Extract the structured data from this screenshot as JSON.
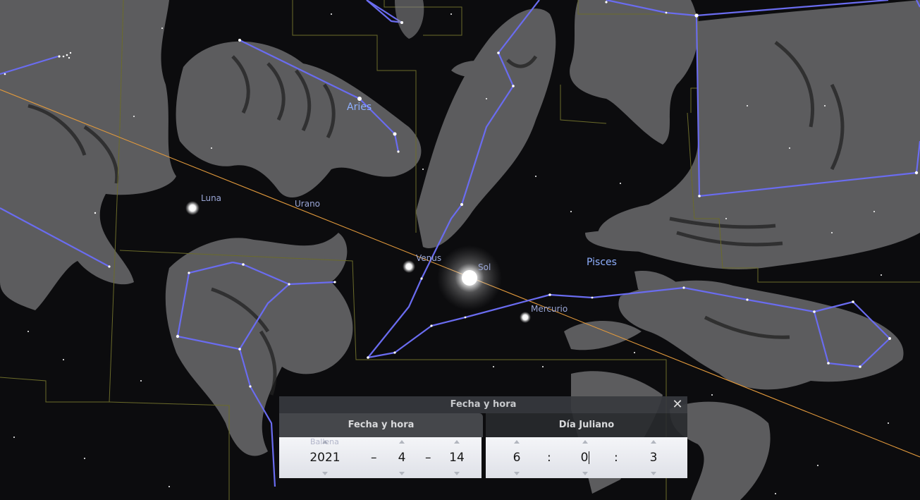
{
  "sky": {
    "labels": {
      "aries": "Aries",
      "pisces": "Pisces",
      "luna": "Luna",
      "urano": "Urano",
      "venus": "Venus",
      "sol": "Sol",
      "mercurio": "Mercurio",
      "ballena": "Ballena"
    },
    "colors": {
      "constellation_lines": "#6a6cf0",
      "ecliptic": "#e39a3c",
      "boundaries": "#6b6b2a",
      "art": "#9a9a9a"
    }
  },
  "dialog": {
    "title": "Fecha y hora",
    "close_icon": "close-icon",
    "tabs": [
      {
        "label": "Fecha y hora",
        "active": true
      },
      {
        "label": "Día Juliano",
        "active": false
      }
    ],
    "date": {
      "year": "2021",
      "month": "4",
      "day": "14",
      "separator": "–"
    },
    "time": {
      "hour": "6",
      "minute": "0",
      "second": "3",
      "separator": ":"
    }
  }
}
